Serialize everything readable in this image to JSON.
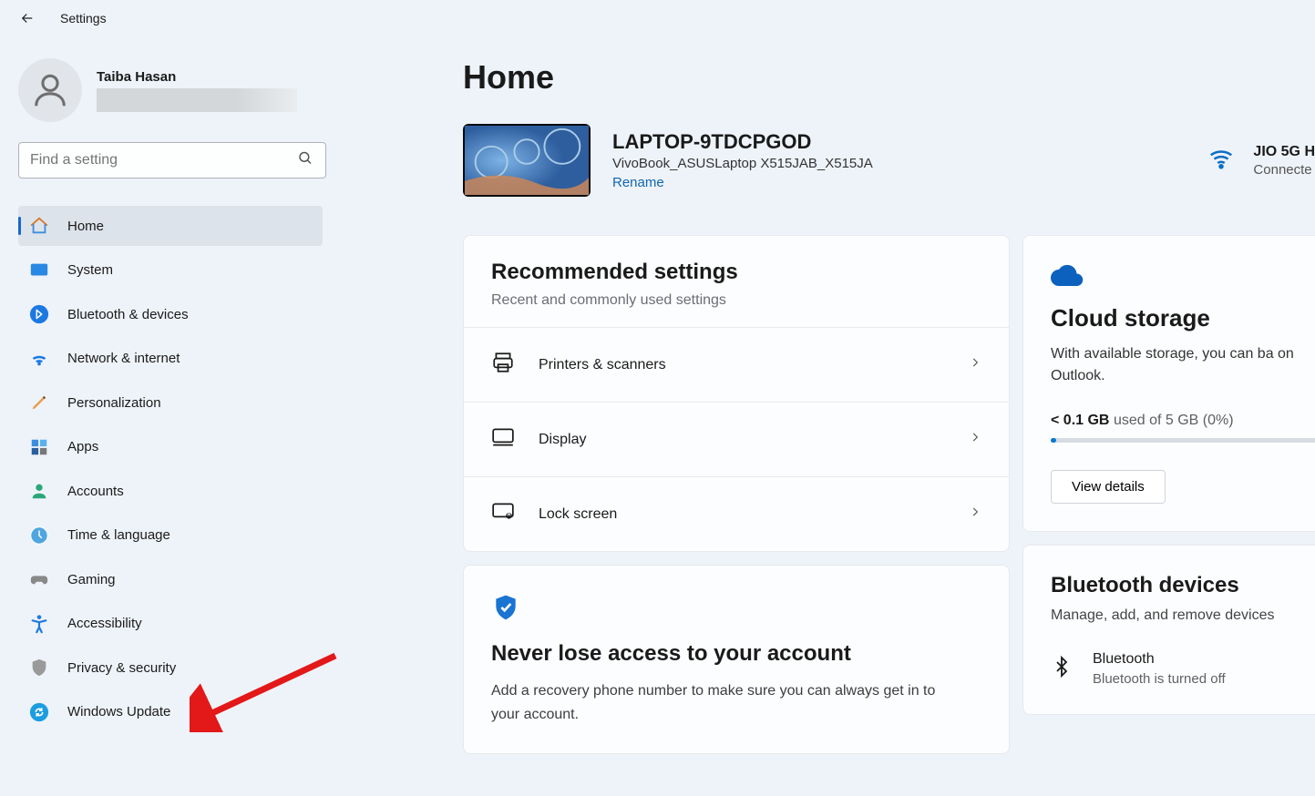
{
  "titlebar": {
    "title": "Settings"
  },
  "profile": {
    "name": "Taiba Hasan"
  },
  "search": {
    "placeholder": "Find a setting"
  },
  "sidebar": {
    "items": [
      {
        "label": "Home"
      },
      {
        "label": "System"
      },
      {
        "label": "Bluetooth & devices"
      },
      {
        "label": "Network & internet"
      },
      {
        "label": "Personalization"
      },
      {
        "label": "Apps"
      },
      {
        "label": "Accounts"
      },
      {
        "label": "Time & language"
      },
      {
        "label": "Gaming"
      },
      {
        "label": "Accessibility"
      },
      {
        "label": "Privacy & security"
      },
      {
        "label": "Windows Update"
      }
    ]
  },
  "page": {
    "title": "Home"
  },
  "device": {
    "name": "LAPTOP-9TDCPGOD",
    "model": "VivoBook_ASUSLaptop X515JAB_X515JA",
    "rename": "Rename"
  },
  "wifi": {
    "name": "JIO 5G H",
    "status": "Connecte"
  },
  "recommended": {
    "title": "Recommended settings",
    "subtitle": "Recent and commonly used settings",
    "items": [
      {
        "label": "Printers & scanners"
      },
      {
        "label": "Display"
      },
      {
        "label": "Lock screen"
      }
    ]
  },
  "account_card": {
    "title": "Never lose access to your account",
    "subtitle": "Add a recovery phone number to make sure you can always get in to your account."
  },
  "cloud": {
    "title": "Cloud storage",
    "subtitle": "With available storage, you can ba on Outlook.",
    "used_label": "< 0.1 GB",
    "rest": "used of 5 GB (0%)",
    "button": "View details"
  },
  "bluetooth": {
    "title": "Bluetooth devices",
    "subtitle": "Manage, add, and remove devices",
    "item_name": "Bluetooth",
    "item_status": "Bluetooth is turned off"
  }
}
